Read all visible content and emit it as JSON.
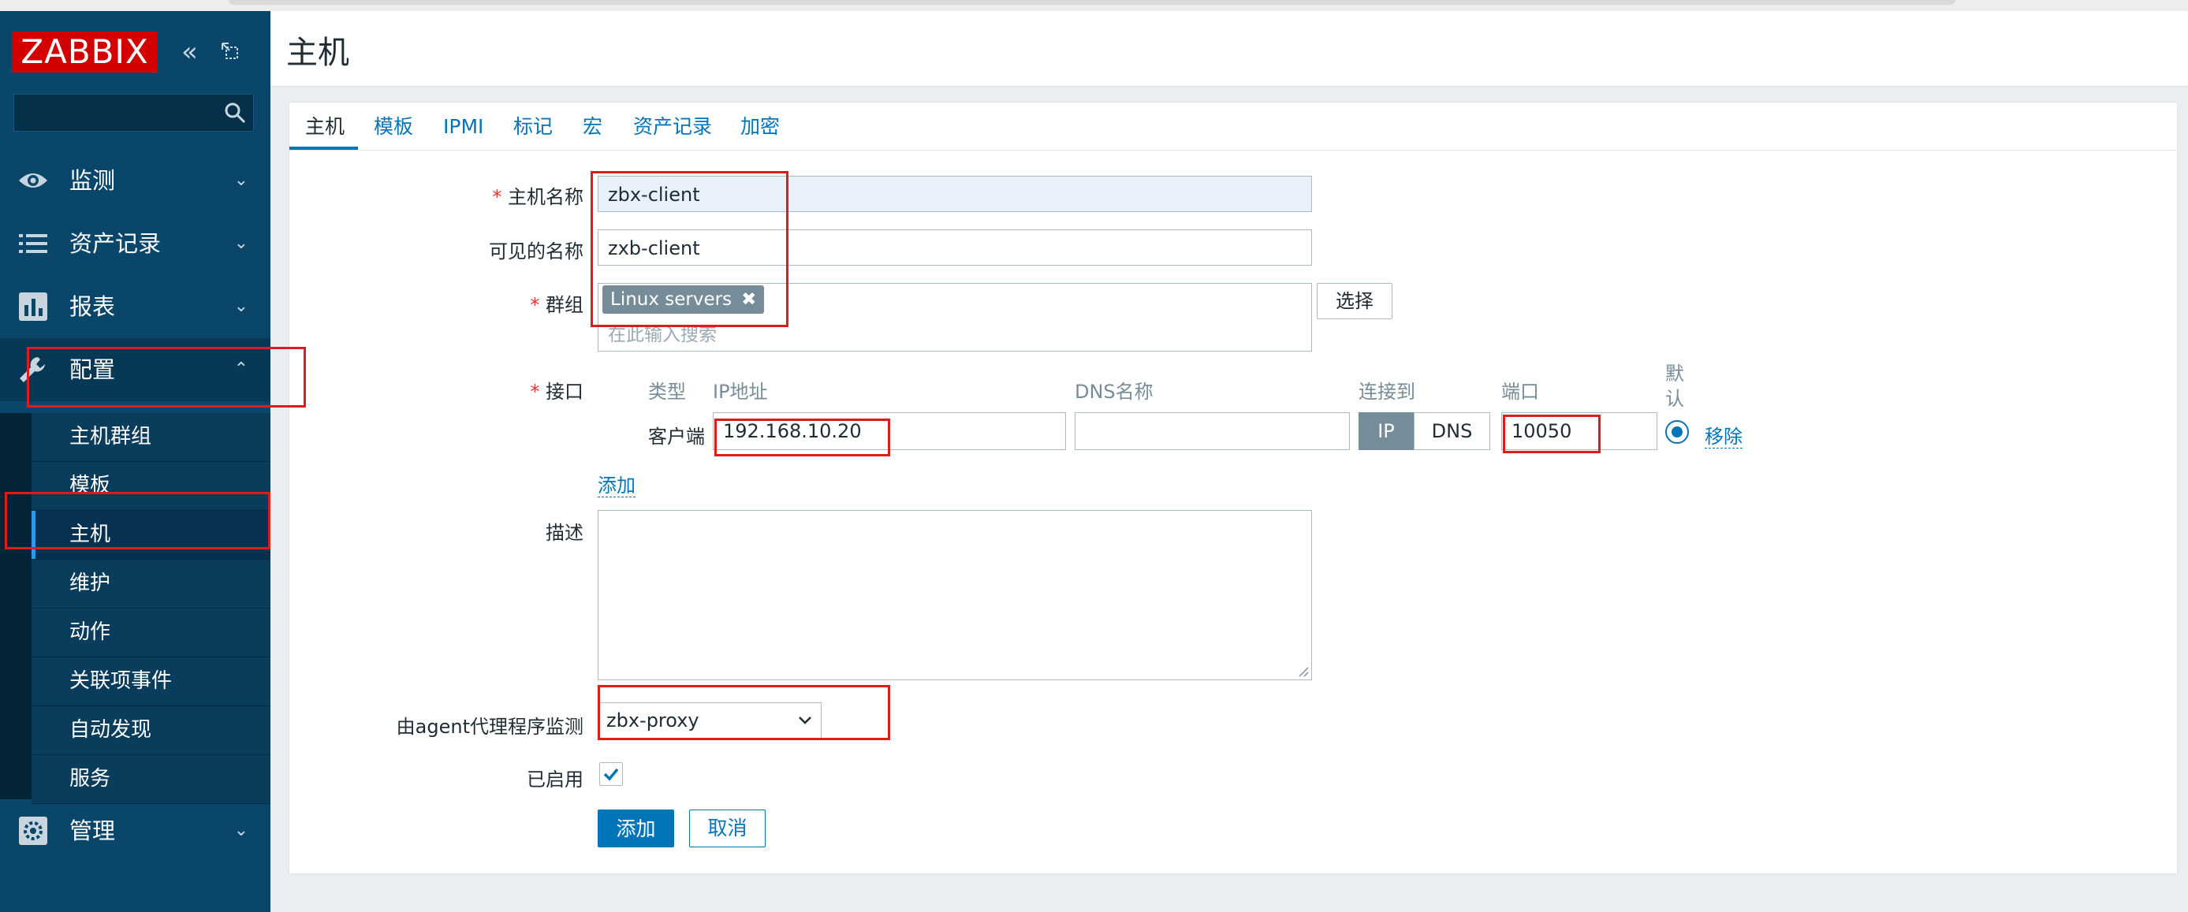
{
  "app": {
    "logo": "ZABBIX"
  },
  "sidebar": {
    "menu": [
      {
        "label": "监测",
        "icon": "eye-icon"
      },
      {
        "label": "资产记录",
        "icon": "list-icon"
      },
      {
        "label": "报表",
        "icon": "bar-chart-icon"
      },
      {
        "label": "配置",
        "icon": "wrench-icon"
      },
      {
        "label": "管理",
        "icon": "gear-icon"
      }
    ],
    "submenu": [
      "主机群组",
      "模板",
      "主机",
      "维护",
      "动作",
      "关联项事件",
      "自动发现",
      "服务"
    ],
    "chevron_down": "⌄",
    "chevron_up": "⌃"
  },
  "header": {
    "title": "主机"
  },
  "tabs": [
    "主机",
    "模板",
    "IPMI",
    "标记",
    "宏",
    "资产记录",
    "加密"
  ],
  "form": {
    "required_mark": "*",
    "host_name_label": "主机名称",
    "host_name_value": "zbx-client",
    "visible_name_label": "可见的名称",
    "visible_name_value": "zxb-client",
    "groups_label": "群组",
    "group_chip": "Linux servers",
    "group_chip_remove": "✖",
    "groups_placeholder": "在此输入搜索",
    "select_button": "选择",
    "interfaces_label": "接口",
    "iface_headers": {
      "type": "类型",
      "ip": "IP地址",
      "dns": "DNS名称",
      "connect_to": "连接到",
      "port": "端口",
      "default": "默认"
    },
    "iface_row": {
      "type": "客户端",
      "ip": "192.168.10.20",
      "dns": "",
      "connect_ip": "IP",
      "connect_dns": "DNS",
      "port": "10050",
      "remove": "移除"
    },
    "add_interface": "添加",
    "description_label": "描述",
    "proxy_label": "由agent代理程序监测",
    "proxy_value": "zbx-proxy",
    "enabled_label": "已启用",
    "enabled": true,
    "add_button": "添加",
    "cancel_button": "取消"
  },
  "colors": {
    "sidebar": "#0a466a",
    "accent": "#0275b8",
    "logo_red": "#d40000",
    "annotation_red": "#e01b1b"
  }
}
